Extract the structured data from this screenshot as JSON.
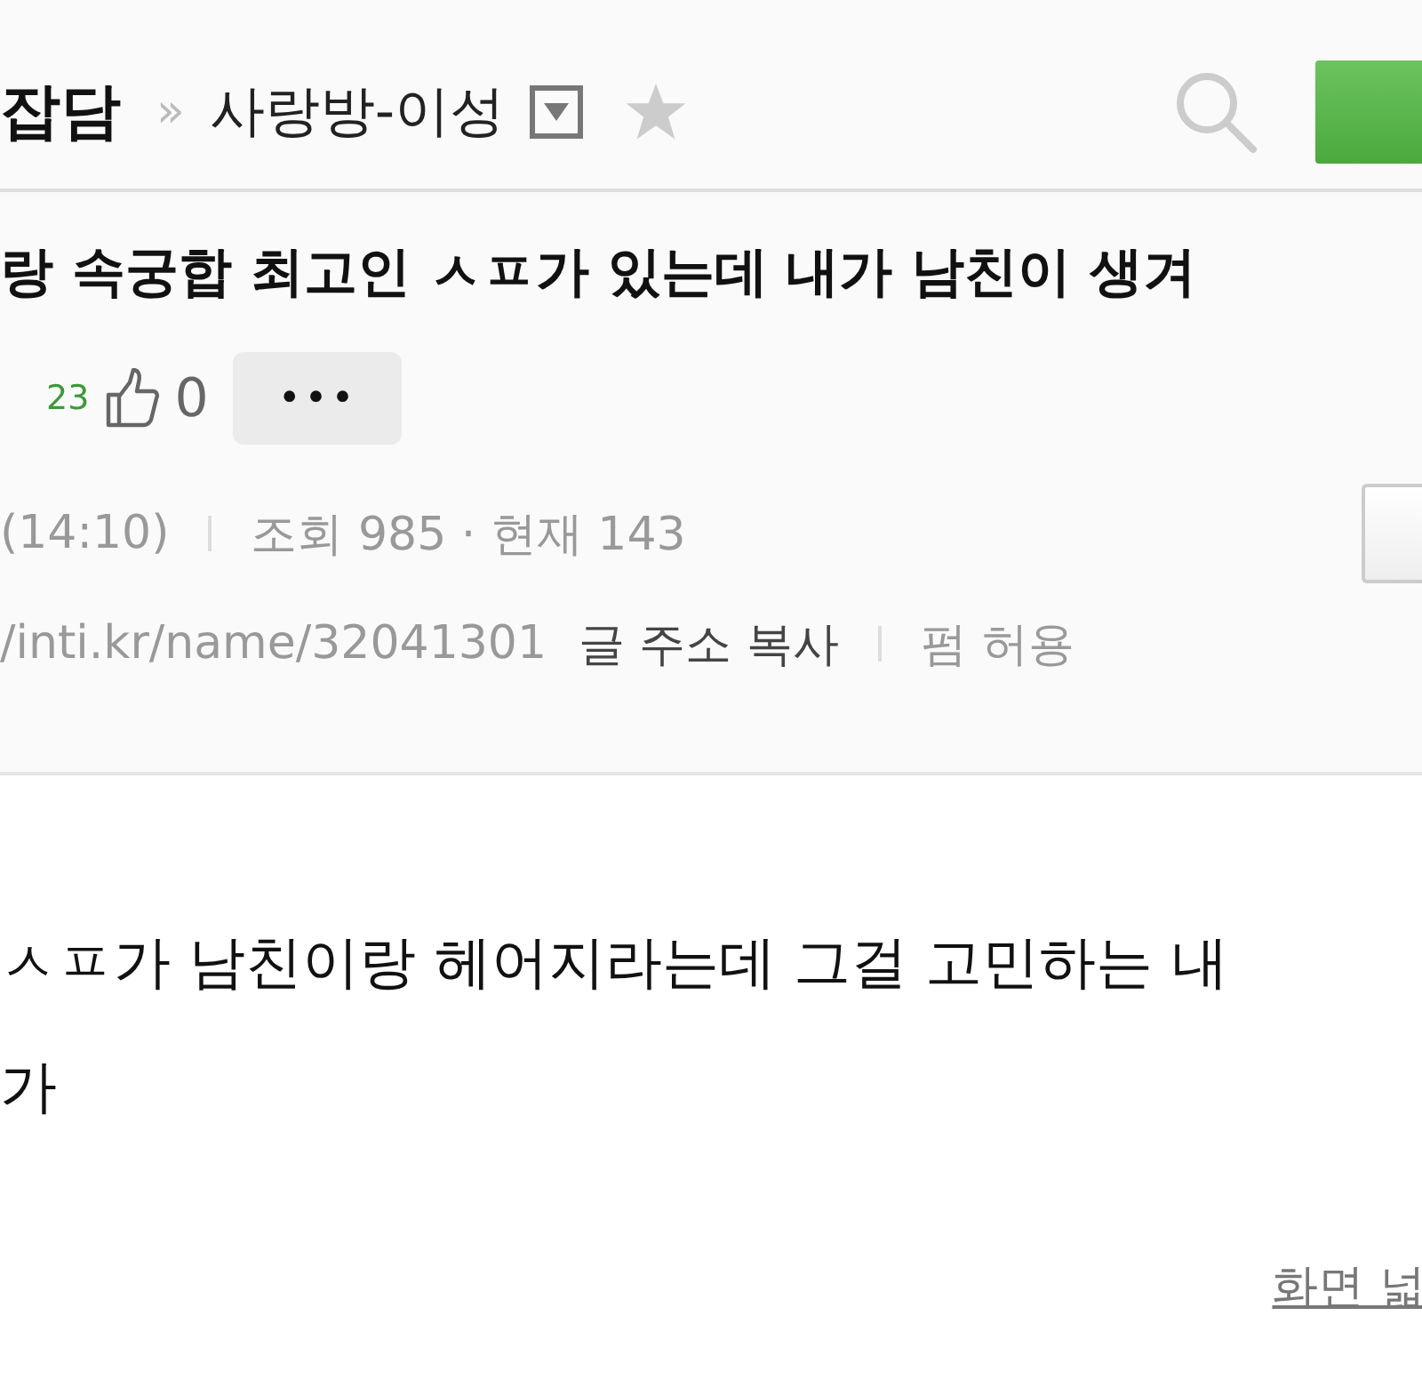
{
  "header": {
    "board": "잡담",
    "separator": "»",
    "category": "사랑방-이성",
    "favorite": false
  },
  "post": {
    "title": "랑 속궁합 최고인 ㅅㅍ가 있는데 내가 남친이 생겨",
    "comment_count": "23",
    "likes": "0",
    "more": "•••",
    "time": "(14:10)",
    "views": "조회 985 · 현재 143",
    "url": "/inti.kr/name/32041301",
    "copy_link": "글 주소 복사",
    "share": "펌 허용"
  },
  "body": {
    "lines": [
      "ㅅㅍ가 남친이랑 헤어지라는데 그걸 고민하는 내",
      "가"
    ],
    "wide_link": "화면 넓"
  }
}
